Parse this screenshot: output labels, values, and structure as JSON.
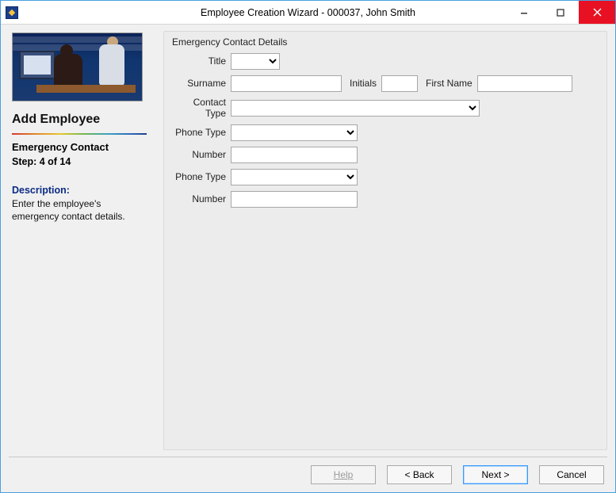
{
  "window": {
    "title": "Employee Creation Wizard  - 000037, John Smith"
  },
  "sidebar": {
    "heading": "Add Employee",
    "step_name": "Emergency Contact",
    "step_count": "Step: 4 of 14",
    "description_label": "Description:",
    "description_text": "Enter the employee's emergency contact details."
  },
  "form": {
    "group_title": "Emergency Contact Details",
    "labels": {
      "title": "Title",
      "surname": "Surname",
      "initials": "Initials",
      "first_name": "First Name",
      "contact_type": "Contact Type",
      "phone_type_1": "Phone Type",
      "number_1": "Number",
      "phone_type_2": "Phone Type",
      "number_2": "Number"
    },
    "values": {
      "title": "",
      "surname": "",
      "initials": "",
      "first_name": "",
      "contact_type": "",
      "phone_type_1": "",
      "number_1": "",
      "phone_type_2": "",
      "number_2": ""
    }
  },
  "footer": {
    "help": "Help",
    "back": "< Back",
    "next": "Next >",
    "cancel": "Cancel"
  }
}
